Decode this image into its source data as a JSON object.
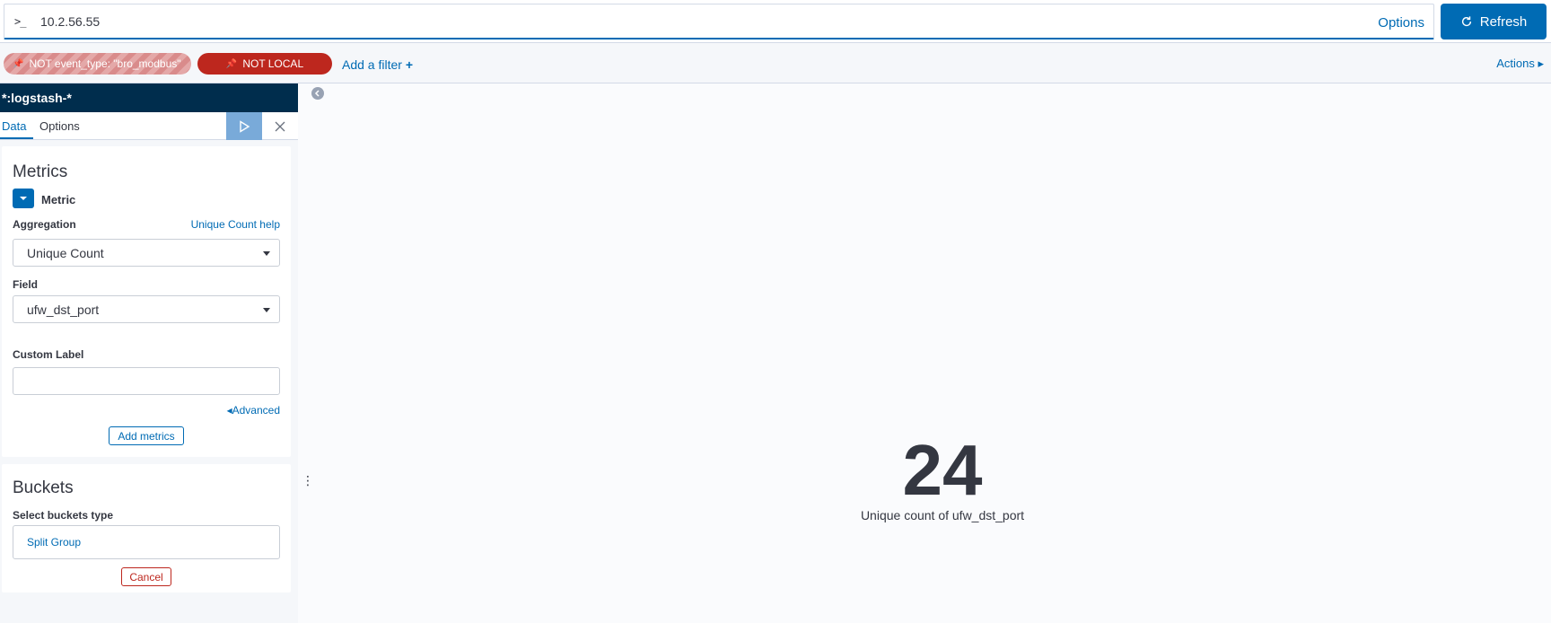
{
  "query": {
    "prompt": ">_",
    "value": "10.2.56.55",
    "options_label": "Options"
  },
  "refresh": {
    "label": "Refresh"
  },
  "filters": [
    {
      "label": "NOT event_type: \"bro_modbus\"",
      "state": "disabled"
    },
    {
      "label": "NOT LOCAL",
      "state": "active"
    }
  ],
  "add_filter": "Add a filter",
  "actions_label": "Actions",
  "sidebar": {
    "index_pattern": "*:logstash-*",
    "tabs": [
      "Data",
      "Options"
    ],
    "metrics": {
      "title": "Metrics",
      "metric_label": "Metric",
      "aggregation_label": "Aggregation",
      "help_link": "Unique Count help",
      "aggregation_value": "Unique Count",
      "field_label": "Field",
      "field_value": "ufw_dst_port",
      "custom_label": "Custom Label",
      "custom_value": "",
      "advanced_link": "Advanced",
      "add_button": "Add metrics"
    },
    "buckets": {
      "title": "Buckets",
      "type_label": "Select buckets type",
      "option": "Split Group",
      "cancel": "Cancel"
    }
  },
  "visualization": {
    "value": "24",
    "label": "Unique count of ufw_dst_port"
  },
  "colors": {
    "accent": "#006bb4",
    "danger": "#bd271e",
    "header": "#002d4d"
  }
}
